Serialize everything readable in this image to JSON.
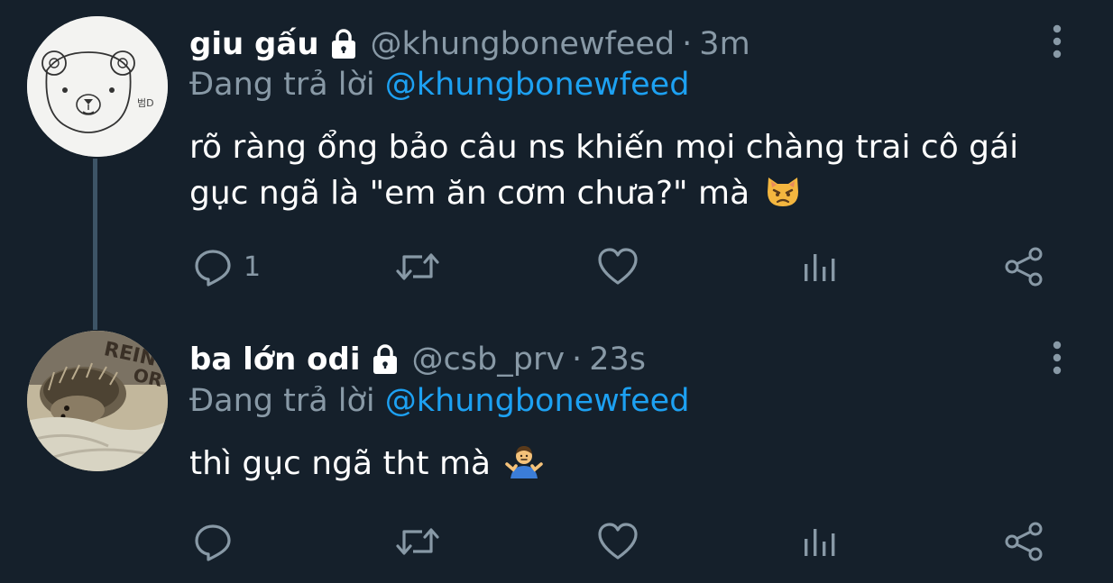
{
  "tweets": [
    {
      "display_name": "giu gấu",
      "handle": "@khungbonewfeed",
      "separator": "·",
      "time": "3m",
      "reply_prefix": "Đang trả lời",
      "reply_mention": "@khungbonewfeed",
      "text": "rõ ràng ổng bảo câu ns khiến mọi chàng trai cô gái gục ngã là \"em ăn cơm chưa?\" mà",
      "emoji": "pouting-cat-emoji",
      "avatar": "bear-drawing-avatar",
      "reply_count": "1"
    },
    {
      "display_name": "ba lớn odi",
      "handle": "@csb_prv",
      "separator": "·",
      "time": "23s",
      "reply_prefix": "Đang trả lời",
      "reply_mention": "@khungbonewfeed",
      "text": "thì gục ngã tht mà",
      "emoji": "person-shrugging-emoji",
      "avatar": "hedgehog-photo-avatar",
      "reply_count": ""
    }
  ],
  "icons": {
    "lock": "lock-icon",
    "more": "more-vertical-icon",
    "reply": "reply-icon",
    "retweet": "retweet-icon",
    "like": "heart-icon",
    "stats": "analytics-icon",
    "share": "share-icon"
  },
  "colors": {
    "background": "#15202b",
    "text": "#ffffff",
    "secondary": "#8899a6",
    "accent": "#1da1f2",
    "thread_line": "#3d5466"
  }
}
